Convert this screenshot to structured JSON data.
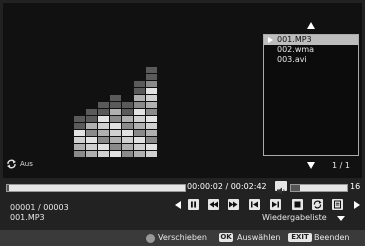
{
  "playlist": {
    "items": [
      {
        "label": "001.MP3",
        "selected": true
      },
      {
        "label": "002.wma",
        "selected": false
      },
      {
        "label": "003.avi",
        "selected": false
      }
    ],
    "page": "1 / 1"
  },
  "repeat": {
    "icon": "repeat-icon",
    "label": "Aus"
  },
  "playback": {
    "time": "00:00:02 / 00:02:42",
    "progress_fraction": 0.012,
    "volume": "16",
    "volume_fraction": 0.16,
    "counter": "00001 / 00003",
    "filename": "001.MP3",
    "mode_label": "Wiedergabeliste"
  },
  "equalizer": {
    "column_levels": [
      6,
      7,
      8,
      9,
      8,
      11,
      13
    ]
  },
  "footer": {
    "move_label": "Verschieben",
    "ok_key": "OK",
    "ok_label": "Auswählen",
    "exit_key": "EXIT",
    "exit_label": "Beenden"
  },
  "colors": {
    "background": "#111111",
    "panel": "#222222",
    "highlight": "#bdbdbd"
  }
}
